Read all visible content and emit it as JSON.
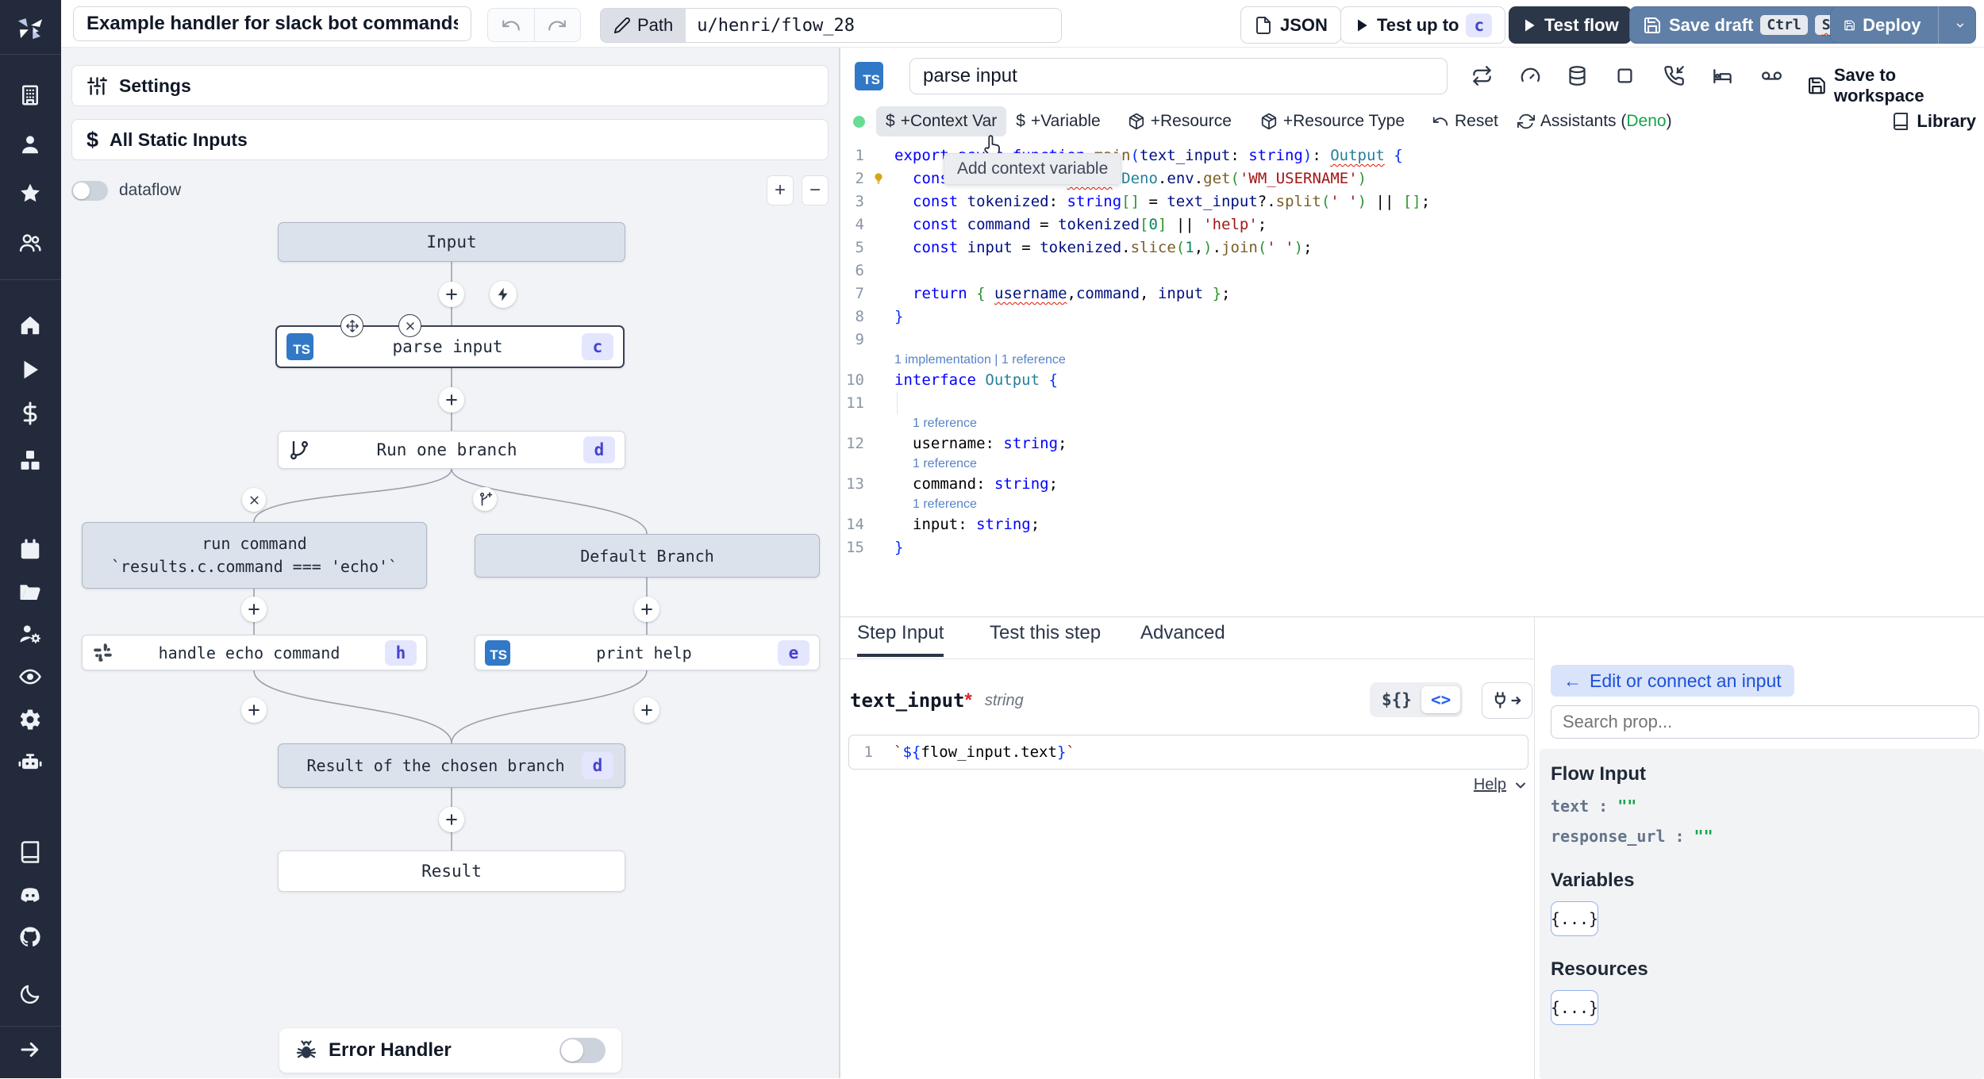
{
  "topbar": {
    "title": "Example handler for slack bot commands",
    "path_label": "Path",
    "path_value": "u/henri/flow_28",
    "json_button": "JSON",
    "test_up_to": "Test up to",
    "test_up_to_step": "c",
    "test_flow": "Test flow",
    "save_draft": "Save draft",
    "kbd_ctrl": "Ctrl",
    "kbd_s": "S",
    "deploy": "Deploy"
  },
  "sidebar": {
    "icons": [
      "building",
      "user",
      "star",
      "users",
      "home",
      "play",
      "dollar",
      "boxes",
      "calendar",
      "folder-open",
      "user-cog",
      "eye",
      "gear",
      "robot",
      "book",
      "discord",
      "github",
      "moon",
      "arrow-right"
    ]
  },
  "flow": {
    "settings": "Settings",
    "all_static_inputs": "All Static Inputs",
    "dataflow": "dataflow",
    "zoom_in": "+",
    "zoom_out": "−",
    "nodes": {
      "input": {
        "label": "Input"
      },
      "parse_input": {
        "label": "parse input",
        "lang": "TS",
        "badge": "c"
      },
      "run_one_branch": {
        "label": "Run one branch",
        "badge": "d"
      },
      "run_command": {
        "label": "run command",
        "sublabel": "`results.c.command === 'echo'`"
      },
      "default_branch": {
        "label": "Default Branch"
      },
      "handle_echo": {
        "label": "handle echo command",
        "badge": "h"
      },
      "print_help": {
        "label": "print help",
        "lang": "TS",
        "badge": "e"
      },
      "chosen_result": {
        "label": "Result of the chosen branch",
        "badge": "d"
      },
      "result": {
        "label": "Result"
      }
    },
    "error_handler": "Error Handler"
  },
  "editor": {
    "lang_badge": "TS",
    "step_name": "parse input",
    "toolbar_icons": [
      "repeat",
      "gauge",
      "database",
      "square",
      "phone-incoming",
      "bed",
      "voicemail"
    ],
    "save_to_workspace": "Save to workspace",
    "actions": {
      "context_var": "+Context Var",
      "variable": "+Variable",
      "resource": "+Resource",
      "resource_type": "+Resource Type",
      "reset": "Reset",
      "assistants_prefix": "Assistants (",
      "assistants_lang": "Deno",
      "assistants_suffix": ")",
      "library": "Library"
    },
    "tooltip": "Add context variable",
    "code": [
      {
        "no": "1",
        "segs": [
          [
            "k",
            "export"
          ],
          [
            "d",
            " "
          ],
          [
            "k",
            "async"
          ],
          [
            "d",
            " "
          ],
          [
            "k",
            "function"
          ],
          [
            "d",
            " "
          ],
          [
            "f",
            "main"
          ],
          [
            "p1",
            "("
          ],
          [
            "v",
            "text_input"
          ],
          [
            "d",
            ": "
          ],
          [
            "k",
            "string"
          ],
          [
            "p1",
            ")"
          ],
          [
            "d",
            ": "
          ],
          [
            "t sq",
            "Output"
          ],
          [
            "d",
            " "
          ],
          [
            "p1",
            "{"
          ]
        ]
      },
      {
        "no": "2",
        "ind": 1,
        "bulb": true,
        "segs": [
          [
            "k",
            "const"
          ],
          [
            "d",
            " "
          ],
          [
            "v",
            "username"
          ],
          [
            "d",
            " = "
          ],
          [
            "k sq",
            "await"
          ],
          [
            "d",
            " "
          ],
          [
            "t",
            "Deno"
          ],
          [
            "d",
            "."
          ],
          [
            "v",
            "env"
          ],
          [
            "d",
            "."
          ],
          [
            "f",
            "get"
          ],
          [
            "p2",
            "("
          ],
          [
            "s",
            "'WM_USERNAME'"
          ],
          [
            "p2",
            ")"
          ]
        ]
      },
      {
        "no": "3",
        "ind": 1,
        "segs": [
          [
            "k",
            "const"
          ],
          [
            "d",
            " "
          ],
          [
            "v",
            "tokenized"
          ],
          [
            "d",
            ": "
          ],
          [
            "k",
            "string"
          ],
          [
            "p2",
            "[]"
          ],
          [
            "d",
            " = "
          ],
          [
            "v",
            "text_input"
          ],
          [
            "d",
            "?."
          ],
          [
            "f",
            "split"
          ],
          [
            "p2",
            "("
          ],
          [
            "s",
            "' '"
          ],
          [
            "p2",
            ")"
          ],
          [
            "d",
            " || "
          ],
          [
            "p2",
            "[]"
          ],
          [
            "d",
            ";"
          ]
        ]
      },
      {
        "no": "4",
        "ind": 1,
        "segs": [
          [
            "k",
            "const"
          ],
          [
            "d",
            " "
          ],
          [
            "v",
            "command"
          ],
          [
            "d",
            " = "
          ],
          [
            "v",
            "tokenized"
          ],
          [
            "p2",
            "["
          ],
          [
            "n",
            "0"
          ],
          [
            "p2",
            "]"
          ],
          [
            "d",
            " || "
          ],
          [
            "s",
            "'help'"
          ],
          [
            "d",
            ";"
          ]
        ]
      },
      {
        "no": "5",
        "ind": 1,
        "segs": [
          [
            "k",
            "const"
          ],
          [
            "d",
            " "
          ],
          [
            "v",
            "input"
          ],
          [
            "d",
            " = "
          ],
          [
            "v",
            "tokenized"
          ],
          [
            "d",
            "."
          ],
          [
            "f",
            "slice"
          ],
          [
            "p2",
            "("
          ],
          [
            "n",
            "1"
          ],
          [
            "d",
            ","
          ],
          [
            "p2",
            ")"
          ],
          [
            "d",
            "."
          ],
          [
            "f",
            "join"
          ],
          [
            "p2",
            "("
          ],
          [
            "s",
            "' '"
          ],
          [
            "p2",
            ")"
          ],
          [
            "d",
            ";"
          ]
        ]
      },
      {
        "no": "6",
        "segs": []
      },
      {
        "no": "7",
        "ind": 1,
        "segs": [
          [
            "k",
            "return"
          ],
          [
            "d",
            " "
          ],
          [
            "p2",
            "{"
          ],
          [
            "d",
            " "
          ],
          [
            "v sq",
            "username"
          ],
          [
            "d",
            ","
          ],
          [
            "v",
            "command"
          ],
          [
            "d",
            ", "
          ],
          [
            "v",
            "input"
          ],
          [
            "d",
            " "
          ],
          [
            "p2",
            "}"
          ],
          [
            "d",
            ";"
          ]
        ]
      },
      {
        "no": "8",
        "segs": [
          [
            "p1",
            "}"
          ]
        ]
      },
      {
        "no": "9",
        "segs": []
      },
      {
        "lens": "1 implementation | 1 reference"
      },
      {
        "no": "10",
        "segs": [
          [
            "k",
            "interface"
          ],
          [
            "d",
            " "
          ],
          [
            "t",
            "Output"
          ],
          [
            "d",
            " "
          ],
          [
            "p1",
            "{"
          ]
        ]
      },
      {
        "no": "11",
        "guide": true,
        "segs": []
      },
      {
        "lens": "1 reference",
        "ind": 1
      },
      {
        "no": "12",
        "ind": 1,
        "segs": [
          [
            "d",
            "username"
          ],
          [
            "d",
            ": "
          ],
          [
            "k",
            "string"
          ],
          [
            "d",
            ";"
          ]
        ]
      },
      {
        "lens": "1 reference",
        "ind": 1
      },
      {
        "no": "13",
        "ind": 1,
        "segs": [
          [
            "d",
            "command"
          ],
          [
            "d",
            ": "
          ],
          [
            "k",
            "string"
          ],
          [
            "d",
            ";"
          ]
        ]
      },
      {
        "lens": "1 reference",
        "ind": 1
      },
      {
        "no": "14",
        "ind": 1,
        "segs": [
          [
            "d",
            "input"
          ],
          [
            "d",
            ": "
          ],
          [
            "k",
            "string"
          ],
          [
            "d",
            ";"
          ]
        ]
      },
      {
        "no": "15",
        "segs": [
          [
            "p1",
            "}"
          ]
        ]
      }
    ]
  },
  "step_panel": {
    "tabs": [
      "Step Input",
      "Test this step",
      "Advanced"
    ],
    "active_tab": 0,
    "field_name": "text_input",
    "required_mark": "*",
    "field_type": "string",
    "toggle_expr": "${}",
    "toggle_code": "<>",
    "expr_line_no": "1",
    "expr_segs": [
      [
        "s",
        "`"
      ],
      [
        "p1",
        "${"
      ],
      [
        "d",
        "flow_input.text"
      ],
      [
        "p1",
        "}"
      ],
      [
        "s",
        "`"
      ]
    ],
    "help": "Help"
  },
  "connect": {
    "back_arrow": "←",
    "back": "Edit or connect an input",
    "search_placeholder": "Search prop...",
    "flow_input": "Flow Input",
    "props": [
      {
        "name": "text",
        "colon": ":",
        "value": "\"\""
      },
      {
        "name": "response_url",
        "colon": ":",
        "value": "\"\""
      }
    ],
    "variables": "Variables",
    "resources": "Resources",
    "chip": "{...}"
  }
}
